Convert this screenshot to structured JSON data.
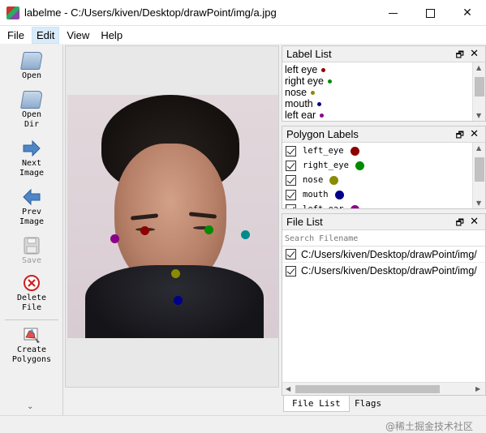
{
  "window": {
    "app_name": "labelme",
    "title": "labelme - C:/Users/kiven/Desktop/drawPoint/img/a.jpg"
  },
  "menu": [
    "File",
    "Edit",
    "View",
    "Help"
  ],
  "menu_active": "Edit",
  "toolbar": {
    "open": "Open",
    "open_dir": "Open\nDir",
    "next_image": "Next\nImage",
    "prev_image": "Prev\nImage",
    "save": "Save",
    "delete_file": "Delete\nFile",
    "create_polygons": "Create\nPolygons"
  },
  "label_list": {
    "title": "Label List",
    "items": [
      {
        "label": "left eye",
        "color": "#8b0000"
      },
      {
        "label": "right eye",
        "color": "#008b00"
      },
      {
        "label": "nose",
        "color": "#8b8b00"
      },
      {
        "label": "mouth",
        "color": "#00008b"
      },
      {
        "label": "left ear",
        "color": "#8b008b"
      }
    ]
  },
  "polygon_labels": {
    "title": "Polygon Labels",
    "items": [
      {
        "label": "left_eye",
        "color": "#8b0000",
        "checked": true
      },
      {
        "label": "right_eye",
        "color": "#008b00",
        "checked": true
      },
      {
        "label": "nose",
        "color": "#8b8b00",
        "checked": true
      },
      {
        "label": "mouth",
        "color": "#00008b",
        "checked": true
      },
      {
        "label": "left_ear",
        "color": "#8b008b",
        "checked": true
      }
    ]
  },
  "file_list": {
    "title": "File List",
    "search_placeholder": "Search Filename",
    "items": [
      {
        "path": "C:/Users/kiven/Desktop/drawPoint/img/",
        "checked": true
      },
      {
        "path": "C:/Users/kiven/Desktop/drawPoint/img/",
        "checked": true
      }
    ]
  },
  "bottom_tabs": [
    "File List",
    "Flags"
  ],
  "watermark": "@稀土掘金技术社区",
  "points": [
    {
      "name": "left_eye",
      "color": "#8b0000"
    },
    {
      "name": "right_eye",
      "color": "#008b00"
    },
    {
      "name": "nose",
      "color": "#8b8b00"
    },
    {
      "name": "mouth",
      "color": "#00008b"
    },
    {
      "name": "left_ear",
      "color": "#8b008b"
    },
    {
      "name": "right_ear",
      "color": "#008b8b"
    }
  ]
}
